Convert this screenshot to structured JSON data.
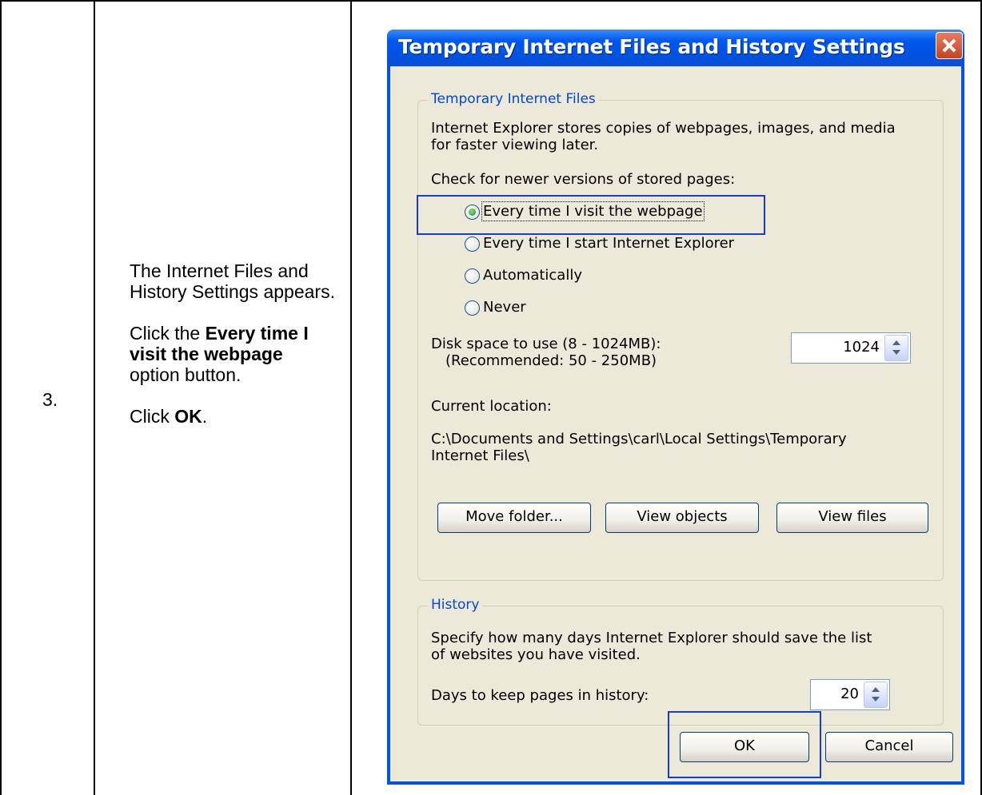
{
  "step": {
    "number": "3.",
    "paragraphs": [
      {
        "plain": "The Internet Files and History Settings appears."
      },
      {
        "pre": "Click the ",
        "bold": "Every time I visit the webpage",
        "post": " option button."
      },
      {
        "pre": "Click ",
        "bold": "OK",
        "post": "."
      }
    ]
  },
  "dialog": {
    "title": "Temporary Internet Files and History Settings",
    "temp_files": {
      "legend": "Temporary Internet Files",
      "description_line1": "Internet Explorer stores copies of webpages, images, and media",
      "description_line2": "for faster viewing later.",
      "check_label": "Check for newer versions of stored pages:",
      "options": [
        {
          "label": "Every time I visit the webpage",
          "checked": true
        },
        {
          "label": "Every time I start Internet Explorer",
          "checked": false
        },
        {
          "label": "Automatically",
          "checked": false
        },
        {
          "label": "Never",
          "checked": false
        }
      ],
      "disk_space_label": "Disk space to use (8 - 1024MB):",
      "disk_space_recommended": "(Recommended: 50 - 250MB)",
      "disk_space_value": "1024",
      "current_location_label": "Current location:",
      "location_line1": "C:\\Documents and Settings\\carl\\Local Settings\\Temporary",
      "location_line2": "Internet Files\\",
      "buttons": {
        "move_folder": "Move folder...",
        "view_objects": "View objects",
        "view_files": "View files"
      }
    },
    "history": {
      "legend": "History",
      "description_line1": "Specify how many days Internet Explorer should save the list",
      "description_line2": "of websites you have visited.",
      "days_label": "Days to keep pages in history:",
      "days_value": "20"
    },
    "ok_label": "OK",
    "cancel_label": "Cancel"
  },
  "colors": {
    "titlebar": "#0058ee",
    "dialog_bg": "#ece9d8",
    "highlight": "#1a3bd1",
    "legend": "#0046d5"
  }
}
